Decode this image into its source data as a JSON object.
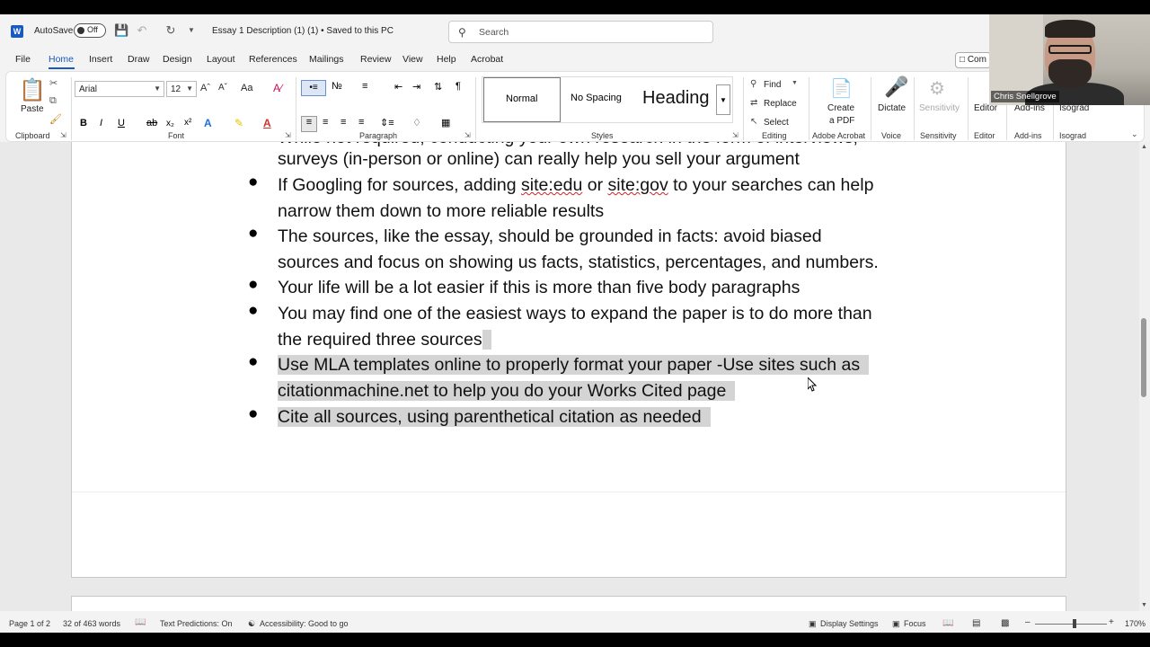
{
  "titlebar": {
    "autosave_label": "AutoSave",
    "autosave_state": "Off",
    "document_title": "Essay 1 Description (1) (1) • Saved to this PC",
    "search_placeholder": "Search"
  },
  "tabs": [
    "File",
    "Home",
    "Insert",
    "Draw",
    "Design",
    "Layout",
    "References",
    "Mailings",
    "Review",
    "View",
    "Help",
    "Acrobat"
  ],
  "active_tab": "Home",
  "comments_button": "Com",
  "ribbon": {
    "clipboard": {
      "paste_label": "Paste",
      "group_label": "Clipboard"
    },
    "font": {
      "family": "Arial",
      "size": "12",
      "group_label": "Font",
      "case_label": "Aa"
    },
    "paragraph": {
      "group_label": "Paragraph"
    },
    "styles": {
      "items": [
        "Normal",
        "No Spacing",
        "Heading"
      ],
      "group_label": "Styles"
    },
    "editing": {
      "find": "Find",
      "replace": "Replace",
      "select": "Select",
      "group_label": "Editing"
    },
    "acrobat": {
      "label": "Create a PDF",
      "label_line1": "Create",
      "label_line2": "a PDF",
      "group_label": "Adobe Acrobat"
    },
    "voice": {
      "label": "Dictate",
      "group_label": "Voice"
    },
    "sensitivity": {
      "label": "Sensitivity",
      "group_label": "Sensitivity"
    },
    "editor": {
      "label": "Editor",
      "group_label": "Editor"
    },
    "addins": {
      "label": "Add-ins",
      "group_label": "Add-ins"
    },
    "isograd": {
      "label": "Isograd",
      "group_label": "Isograd"
    }
  },
  "document": {
    "top_partial_line": "While not required, conducting your own research in the form of interviews,",
    "lines": [
      "surveys (in-person or online) can really help you sell your argument",
      "If Googling for sources, adding site:edu or site:gov to your searches can help",
      "narrow them down to more reliable results",
      "The sources, like the essay, should be grounded in facts: avoid biased",
      "sources and focus on showing us facts, statistics, percentages, and numbers.",
      "Your life will be a lot easier if this is more than five body paragraphs",
      "You may find one of the easiest ways to expand the paper is to do more than",
      "the required three sources",
      "Use MLA templates online to properly format your paper -Use sites such as",
      "citationmachine.net to help you do your Works Cited page",
      "Cite all sources, using parenthetical citation as needed"
    ],
    "line2_parts": [
      "If Googling for sources, adding ",
      "site:edu",
      " or ",
      "site:gov",
      " to your searches can help"
    ]
  },
  "statusbar": {
    "page": "Page 1 of 2",
    "words": "32 of 463 words",
    "text_predictions": "Text Predictions: On",
    "accessibility": "Accessibility: Good to go",
    "display_settings": "Display Settings",
    "focus": "Focus",
    "zoom": "170%"
  },
  "webcam": {
    "name": "Chris Snellgrove"
  },
  "colors": {
    "accent": "#185abd",
    "selection": "#d4d4d4"
  }
}
